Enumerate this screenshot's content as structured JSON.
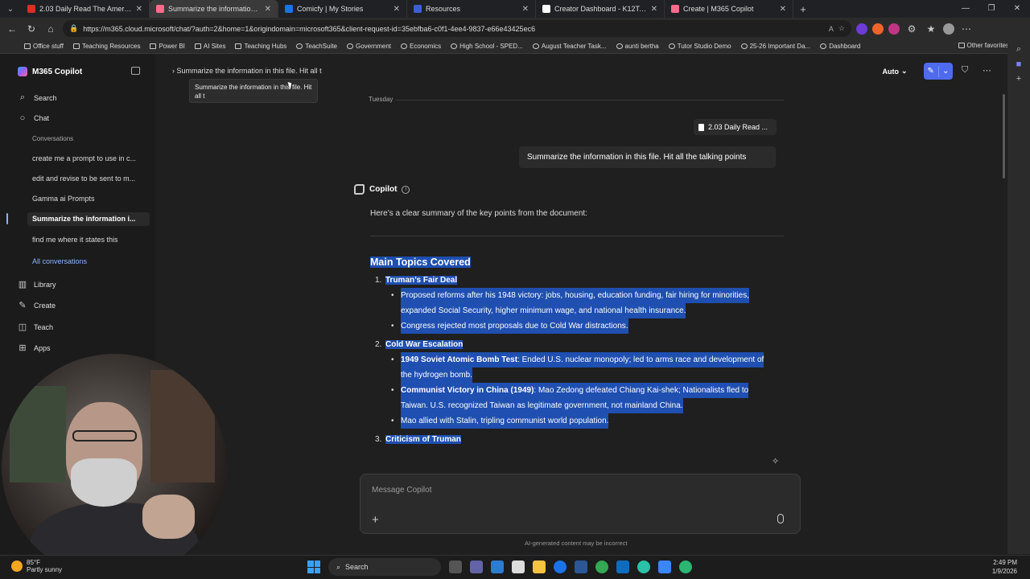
{
  "browser": {
    "tabs": [
      {
        "title": "2.03 Daily Read The American od",
        "color": "#d93025"
      },
      {
        "title": "Summarize the information in this",
        "color": "#ff6a8a",
        "active": true
      },
      {
        "title": "Comicfy | My Stories",
        "color": "#1a73e8"
      },
      {
        "title": "Resources",
        "color": "#3a5fd9"
      },
      {
        "title": "Creator Dashboard - K12TeachSu",
        "color": "#ffffff"
      },
      {
        "title": "Create | M365 Copilot",
        "color": "#ff6a8a"
      }
    ],
    "url": "https://m365.cloud.microsoft/chat/?auth=2&home=1&origindomain=microsoft365&client-request-id=35ebfba6-c0f1-4ee4-9837-e66e43425ec6",
    "bookmarks": [
      "Office stuff",
      "Teaching Resources",
      "Power BI",
      "AI Sites",
      "Teaching Hubs",
      "TeachSuite",
      "Government",
      "Economics",
      "High School - SPED...",
      "August Teacher Task...",
      "aunti bertha",
      "Tutor Studio Demo",
      "25-26 Important Da...",
      "Dashboard"
    ],
    "other_favorites": "Other favorites"
  },
  "sidebar": {
    "app_name": "M365 Copilot",
    "search": "Search",
    "chat": "Chat",
    "conversations_heading": "Conversations",
    "conversations": [
      "create me a prompt to use in c...",
      "edit and revise to be sent to m...",
      "Gamma ai Prompts",
      "Summarize the information i...",
      "find me where it states this"
    ],
    "all_conversations": "All conversations",
    "library": "Library",
    "create": "Create",
    "teach": "Teach",
    "apps": "Apps"
  },
  "header": {
    "breadcrumb": "Summarize the information in this file. Hit all t",
    "tooltip": "Summarize the information in this file. Hit all t",
    "mode": "Auto"
  },
  "chat": {
    "day": "Tuesday",
    "file_chip": "2.03 Daily Read ...",
    "user_message": "Summarize the information in this file.  Hit all the talking points",
    "assistant_name": "Copilot",
    "intro": "Here’s a clear summary of the key points from the document:",
    "section_title": "Main Topics Covered",
    "topics": [
      {
        "num": "1.",
        "title": "Truman’s Fair Deal"
      },
      {
        "num": "2.",
        "title": "Cold War Escalation"
      },
      {
        "num": "3.",
        "title": "Criticism of Truman"
      }
    ],
    "lines": {
      "t1b1a": "Proposed reforms after his 1948 victory: jobs, housing, education funding, fair hiring for minorities,",
      "t1b1b": "expanded Social Security, higher minimum wage, and national health insurance.",
      "t1b2": "Congress rejected most proposals due to Cold War distractions.",
      "t2b1_bold": "1949 Soviet Atomic Bomb Test",
      "t2b1a": ": Ended U.S. nuclear monopoly; led to arms race and development of",
      "t2b1b": "the hydrogen bomb.",
      "t2b2_bold": "Communist Victory in China (1949)",
      "t2b2a": ": Mao Zedong defeated Chiang Kai-shek; Nationalists fled to",
      "t2b2b": "Taiwan. U.S. recognized Taiwan as legitimate government, not mainland China.",
      "t2b3": "Mao allied with Stalin, tripling communist world population."
    },
    "composer_placeholder": "Message Copilot",
    "disclaimer": "AI-generated content may be incorrect"
  },
  "taskbar": {
    "temp": "85°F",
    "weather": "Partly sunny",
    "search": "Search",
    "time": "2:49 PM",
    "date": "1/9/2026"
  },
  "colors": {
    "highlight": "#1f4fb0",
    "accent": "#4f6bed",
    "link": "#8ab4ff"
  }
}
